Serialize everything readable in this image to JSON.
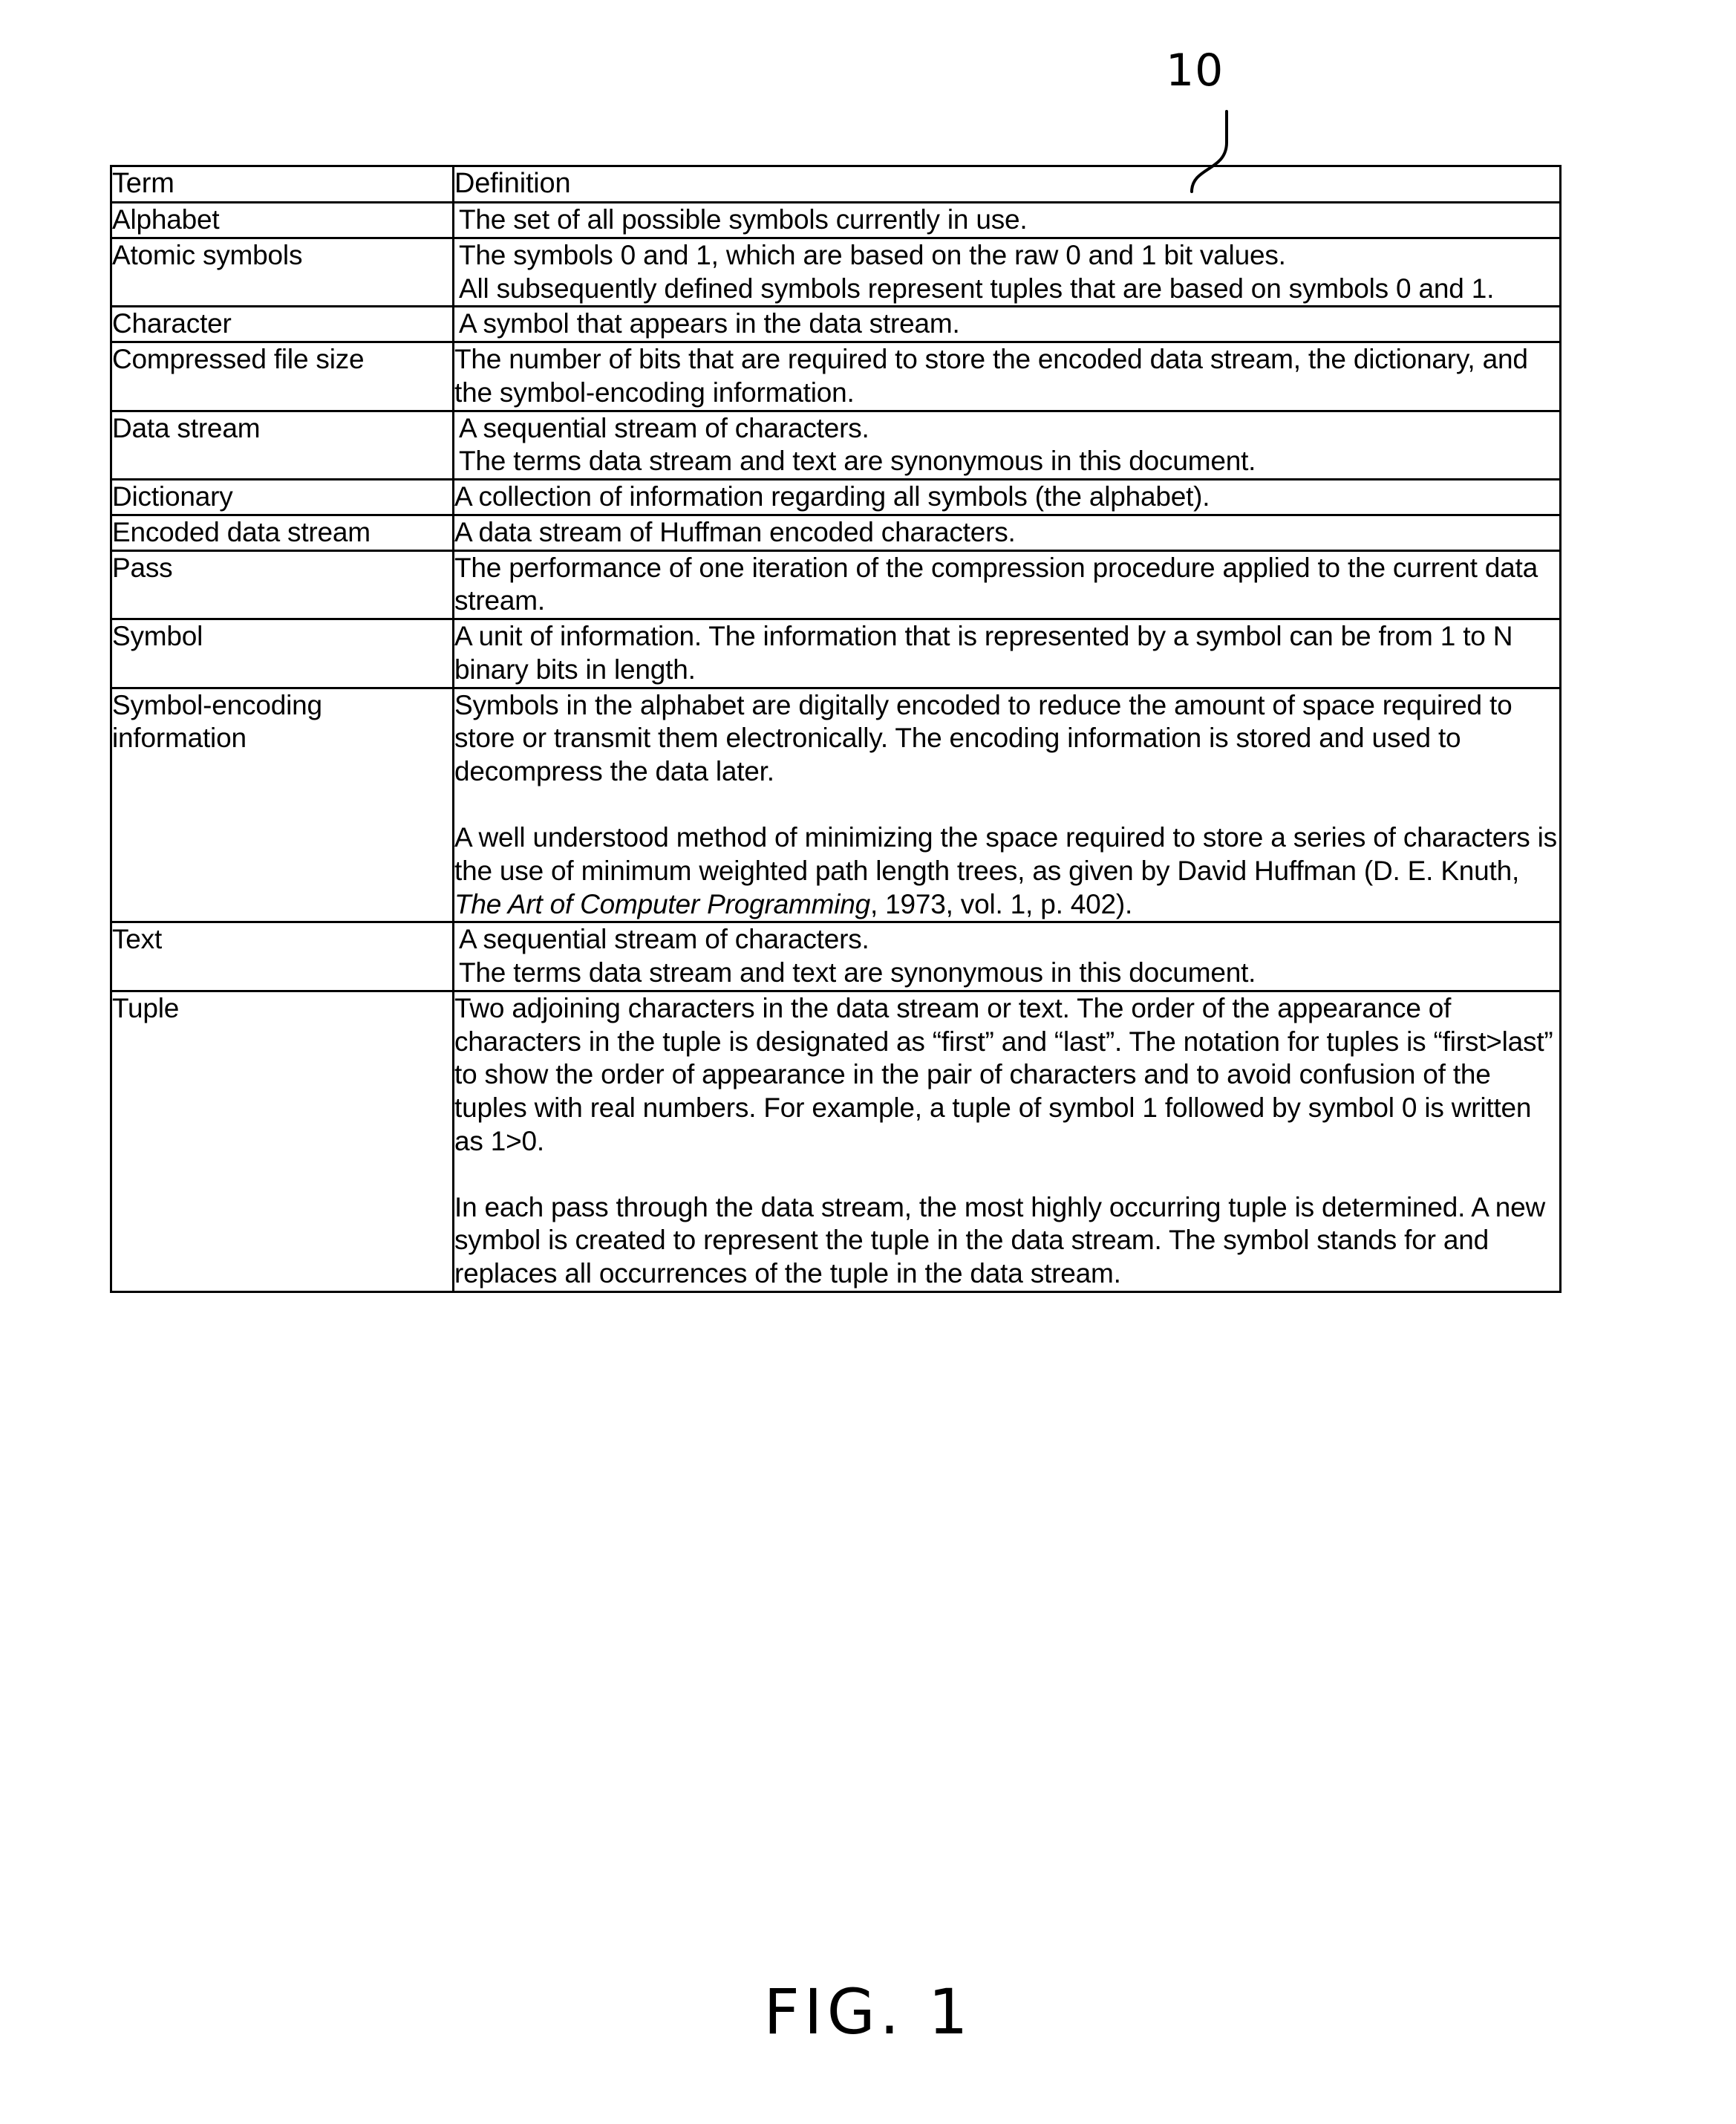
{
  "figure": {
    "reference_numeral": "10",
    "caption": "FIG. 1"
  },
  "table": {
    "headers": {
      "term": "Term",
      "definition": "Definition"
    },
    "rows": [
      {
        "term": "Alphabet",
        "definition": "The set of all possible symbols currently in use.",
        "indent": false
      },
      {
        "term": "Atomic symbols",
        "definition": "The symbols 0 and 1, which are based on the raw 0 and 1 bit values.\nAll subsequently defined symbols represent tuples that are based on symbols 0 and 1.",
        "indent": true
      },
      {
        "term": "Character",
        "definition": "A symbol that appears in the data stream.",
        "indent": true
      },
      {
        "term": "Compressed file size",
        "definition": "The number of bits that are required to store the encoded data stream, the dictionary, and the symbol-encoding information.",
        "indent": false
      },
      {
        "term": "Data stream",
        "definition": "A sequential stream of characters.\nThe terms data stream and text are synonymous in this document.",
        "indent": true
      },
      {
        "term": "Dictionary",
        "definition": "A collection of information regarding all symbols (the alphabet).",
        "indent": false
      },
      {
        "term": "Encoded data stream",
        "definition": "A data stream of Huffman encoded characters.",
        "indent": false
      },
      {
        "term": "Pass",
        "definition": "The performance of one iteration of the compression procedure applied to the current data stream.",
        "indent": false
      },
      {
        "term": "Symbol",
        "definition": "A unit of information. The information that is represented by a symbol can be from 1 to N binary bits in length.",
        "indent": false
      },
      {
        "term": "Symbol-encoding information",
        "definition_paragraphs": [
          "Symbols in the alphabet are digitally encoded to reduce the amount of space required to store or transmit them electronically. The encoding information is stored and used to decompress the data later.",
          "A well understood method of minimizing the space required to store a series of characters is the use of minimum weighted path length trees, as given by David Huffman (D. E. Knuth, The Art of Computer Programming, 1973, vol. 1, p. 402)."
        ],
        "citation_italic_title": "The Art of Computer Programming",
        "indent": false
      },
      {
        "term": "Text",
        "definition": "A sequential stream of characters.\nThe terms data stream and text are synonymous in this document.",
        "indent": true
      },
      {
        "term": "Tuple",
        "definition_paragraphs": [
          "Two adjoining characters in the data stream or text. The order of the appearance of characters in the tuple is designated as “first” and “last”. The notation for tuples is “first>last” to show the order of appearance in the pair of characters and to avoid confusion of the tuples with real numbers. For example, a tuple of symbol 1 followed by symbol 0 is written as 1>0.",
          "In each pass through the data stream, the most highly occurring tuple is determined. A new symbol is created to represent the tuple in the data stream. The symbol stands for and replaces all occurrences of the tuple in the data stream."
        ],
        "indent": false
      }
    ]
  }
}
